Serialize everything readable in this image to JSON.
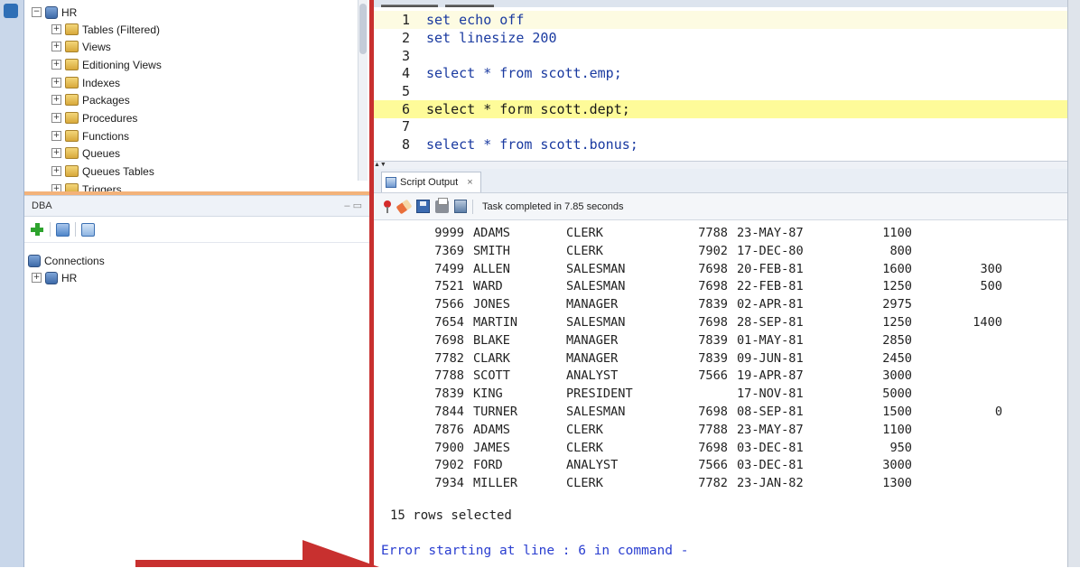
{
  "left_tree": {
    "root": "HR",
    "items": [
      {
        "label": "Tables (Filtered)"
      },
      {
        "label": "Views"
      },
      {
        "label": "Editioning Views"
      },
      {
        "label": "Indexes"
      },
      {
        "label": "Packages"
      },
      {
        "label": "Procedures"
      },
      {
        "label": "Functions"
      },
      {
        "label": "Queues"
      },
      {
        "label": "Queues Tables"
      },
      {
        "label": "Triggers"
      }
    ]
  },
  "dba_panel": {
    "title": "DBA",
    "connections_label": "Connections",
    "connection": "HR"
  },
  "editor": {
    "lines": [
      {
        "num": "1",
        "text": "set echo off"
      },
      {
        "num": "2",
        "text": "set linesize 200"
      },
      {
        "num": "3",
        "text": ""
      },
      {
        "num": "4",
        "text": "select * from scott.emp;"
      },
      {
        "num": "5",
        "text": ""
      },
      {
        "num": "6",
        "text": "select * form scott.dept;"
      },
      {
        "num": "7",
        "text": ""
      },
      {
        "num": "8",
        "text": "select * from scott.bonus;"
      }
    ]
  },
  "output_panel": {
    "tab_label": "Script Output",
    "close_glyph": "×",
    "status": "Task completed in 7.85 seconds",
    "rows": [
      {
        "empno": "9999",
        "ename": "ADAMS",
        "job": "CLERK",
        "mgr": "7788",
        "hiredate": "23-MAY-87",
        "sal": "1100",
        "comm": ""
      },
      {
        "empno": "7369",
        "ename": "SMITH",
        "job": "CLERK",
        "mgr": "7902",
        "hiredate": "17-DEC-80",
        "sal": "800",
        "comm": ""
      },
      {
        "empno": "7499",
        "ename": "ALLEN",
        "job": "SALESMAN",
        "mgr": "7698",
        "hiredate": "20-FEB-81",
        "sal": "1600",
        "comm": "300"
      },
      {
        "empno": "7521",
        "ename": "WARD",
        "job": "SALESMAN",
        "mgr": "7698",
        "hiredate": "22-FEB-81",
        "sal": "1250",
        "comm": "500"
      },
      {
        "empno": "7566",
        "ename": "JONES",
        "job": "MANAGER",
        "mgr": "7839",
        "hiredate": "02-APR-81",
        "sal": "2975",
        "comm": ""
      },
      {
        "empno": "7654",
        "ename": "MARTIN",
        "job": "SALESMAN",
        "mgr": "7698",
        "hiredate": "28-SEP-81",
        "sal": "1250",
        "comm": "1400"
      },
      {
        "empno": "7698",
        "ename": "BLAKE",
        "job": "MANAGER",
        "mgr": "7839",
        "hiredate": "01-MAY-81",
        "sal": "2850",
        "comm": ""
      },
      {
        "empno": "7782",
        "ename": "CLARK",
        "job": "MANAGER",
        "mgr": "7839",
        "hiredate": "09-JUN-81",
        "sal": "2450",
        "comm": ""
      },
      {
        "empno": "7788",
        "ename": "SCOTT",
        "job": "ANALYST",
        "mgr": "7566",
        "hiredate": "19-APR-87",
        "sal": "3000",
        "comm": ""
      },
      {
        "empno": "7839",
        "ename": "KING",
        "job": "PRESIDENT",
        "mgr": "",
        "hiredate": "17-NOV-81",
        "sal": "5000",
        "comm": ""
      },
      {
        "empno": "7844",
        "ename": "TURNER",
        "job": "SALESMAN",
        "mgr": "7698",
        "hiredate": "08-SEP-81",
        "sal": "1500",
        "comm": "0"
      },
      {
        "empno": "7876",
        "ename": "ADAMS",
        "job": "CLERK",
        "mgr": "7788",
        "hiredate": "23-MAY-87",
        "sal": "1100",
        "comm": ""
      },
      {
        "empno": "7900",
        "ename": "JAMES",
        "job": "CLERK",
        "mgr": "7698",
        "hiredate": "03-DEC-81",
        "sal": "950",
        "comm": ""
      },
      {
        "empno": "7902",
        "ename": "FORD",
        "job": "ANALYST",
        "mgr": "7566",
        "hiredate": "03-DEC-81",
        "sal": "3000",
        "comm": ""
      },
      {
        "empno": "7934",
        "ename": "MILLER",
        "job": "CLERK",
        "mgr": "7782",
        "hiredate": "23-JAN-82",
        "sal": "1300",
        "comm": ""
      }
    ],
    "summary": "15 rows selected",
    "error": "Error starting at line : 6 in command -"
  },
  "colors": {
    "accent_red": "#c8302f",
    "error_blue": "#2a3ed0",
    "error_line_highlight": "#fefb99"
  }
}
